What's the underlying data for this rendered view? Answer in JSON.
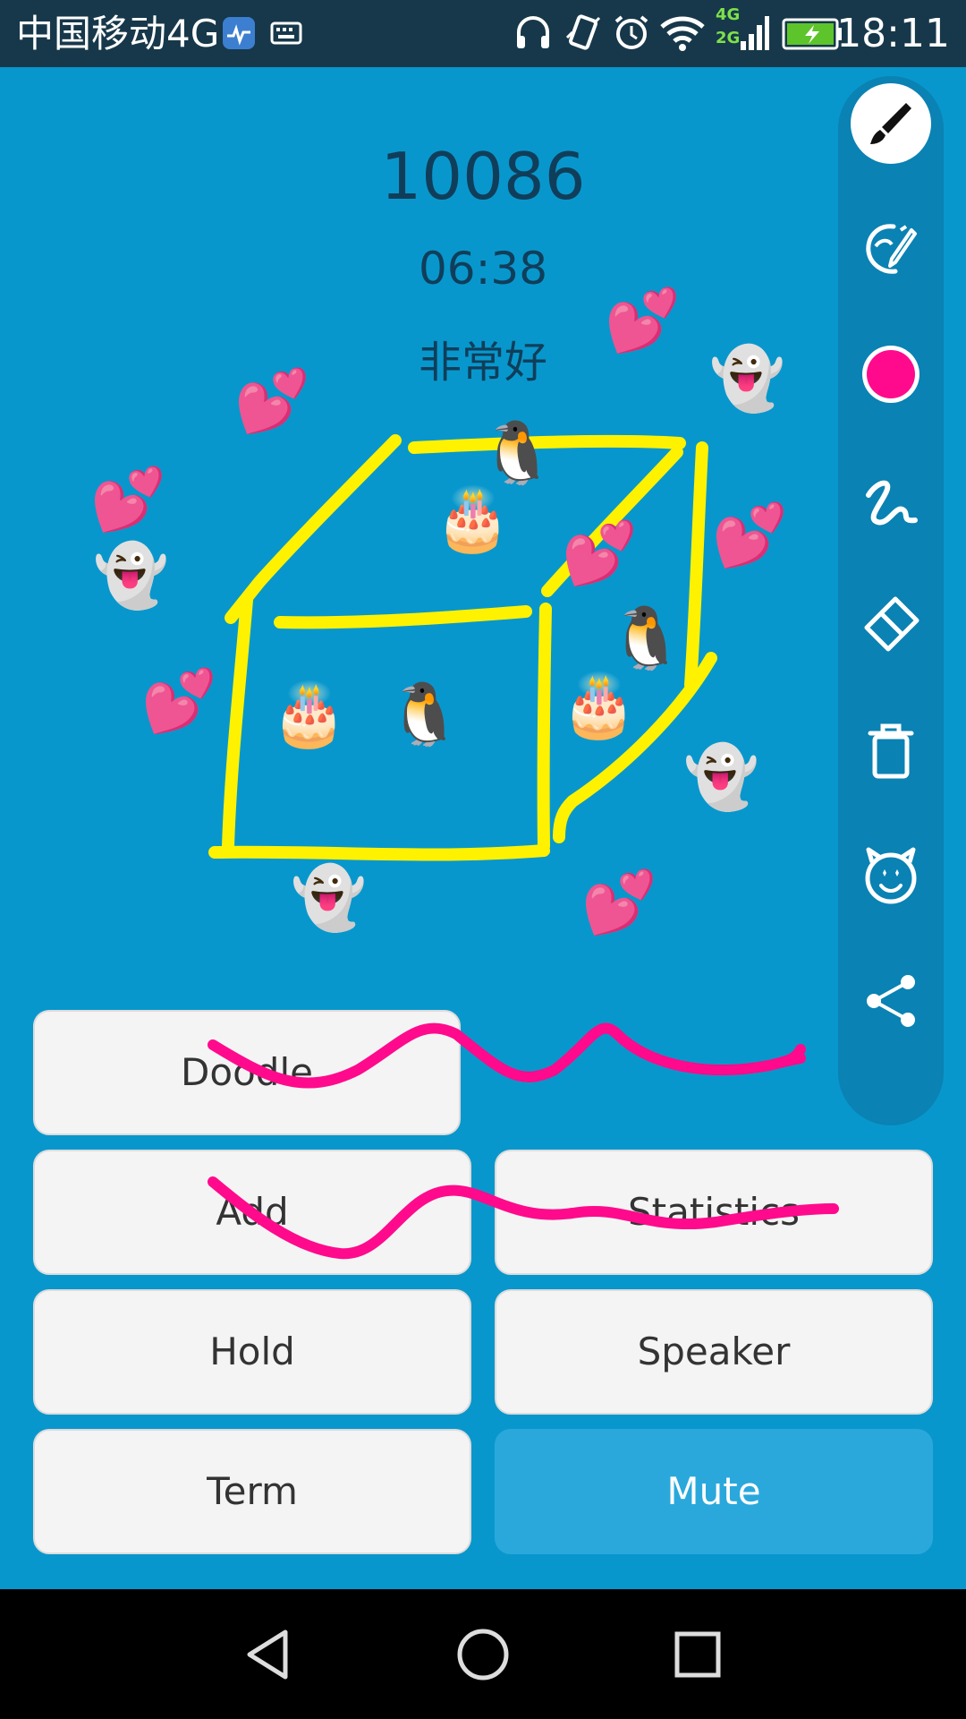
{
  "status_bar": {
    "carrier": "中国移动4G",
    "time": "18:11",
    "network_labels": [
      "4G",
      "2G"
    ]
  },
  "call": {
    "number": "10086",
    "timer": "06:38",
    "status": "非常好"
  },
  "toolbar": {
    "tools": [
      "brush-icon",
      "style-icon",
      "color-icon",
      "scribble-icon",
      "eraser-icon",
      "trash-icon",
      "sticker-icon",
      "share-icon"
    ],
    "selected_color": "#ff0a8c"
  },
  "stickers": {
    "cake": "🎂",
    "penguin": "🐧",
    "ghost": "👻",
    "heart": "💕"
  },
  "buttons": {
    "doodle": "Doodle",
    "add": "Add",
    "statistics": "Statistics",
    "hold": "Hold",
    "speaker": "Speaker",
    "term": "Term",
    "mute": "Mute"
  },
  "colors": {
    "background": "#0897cc",
    "doodle_yellow": "#fff200",
    "doodle_pink": "#ff0a8c",
    "active_button": "#2aa8dc"
  }
}
